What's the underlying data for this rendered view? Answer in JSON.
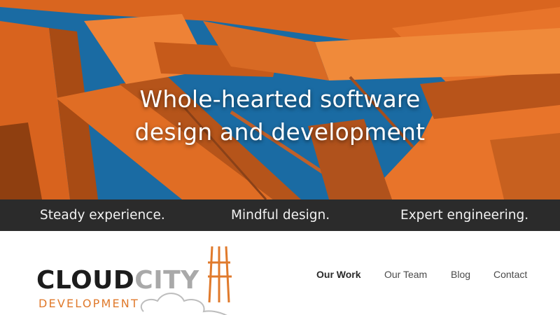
{
  "hero": {
    "title_line1": "Whole-hearted software",
    "title_line2": "design and development",
    "sky_color": "#1c6ea8",
    "bridge_color": "#e8742a"
  },
  "taglines": [
    "Steady experience.",
    "Mindful design.",
    "Expert engineering."
  ],
  "logo": {
    "word1": "CLOUD",
    "word2": "CITY",
    "subtitle": "DEVELOPMENT",
    "accent_color": "#e07a2c"
  },
  "nav": [
    {
      "label": "Our Work",
      "active": true
    },
    {
      "label": "Our Team",
      "active": false
    },
    {
      "label": "Blog",
      "active": false
    },
    {
      "label": "Contact",
      "active": false
    }
  ]
}
